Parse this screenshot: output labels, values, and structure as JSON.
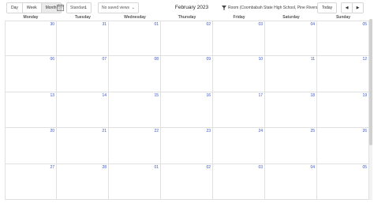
{
  "toolbar": {
    "views": [
      "Day",
      "Week",
      "Month"
    ],
    "active_view": "Month",
    "standard_label": "Standard",
    "saved_views_label": "No saved views",
    "title": "February 2023",
    "room_filter": "Room (Coombabah State High School, Pine Rivers)",
    "today_label": "Today",
    "prev_icon": "caret-left-icon",
    "next_icon": "caret-right-icon",
    "calendar_icon": "calendar-icon",
    "filter_icon": "funnel-icon"
  },
  "calendar": {
    "weekdays": [
      "Monday",
      "Tuesday",
      "Wednesday",
      "Thursday",
      "Friday",
      "Saturday",
      "Sunday"
    ],
    "weeks": [
      [
        "30",
        "31",
        "01",
        "02",
        "03",
        "04",
        "05"
      ],
      [
        "06",
        "07",
        "08",
        "09",
        "10",
        "11",
        "12"
      ],
      [
        "13",
        "14",
        "15",
        "16",
        "17",
        "18",
        "19"
      ],
      [
        "20",
        "21",
        "22",
        "23",
        "24",
        "25",
        "26"
      ],
      [
        "27",
        "28",
        "01",
        "02",
        "03",
        "04",
        "05"
      ]
    ]
  },
  "colors": {
    "day_number": "#3a55c7",
    "grid_line": "#e0e0e0",
    "active_view_bg": "#eaeaea"
  }
}
